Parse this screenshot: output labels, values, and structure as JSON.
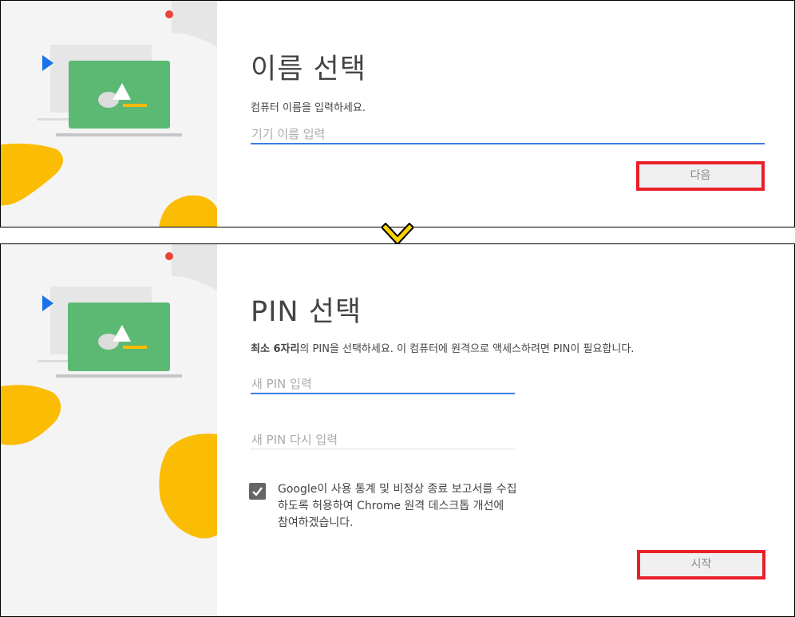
{
  "name_step": {
    "title": "이름 선택",
    "description": "컴퓨터 이름을 입력하세요.",
    "device_name_placeholder": "기기 이름 입력",
    "next_button": "다음"
  },
  "pin_step": {
    "title": "PIN 선택",
    "description_bold": "최소 6자리",
    "description_rest": "의 PIN을 선택하세요. 이 컴퓨터에 원격으로 액세스하려면 PIN이 필요합니다.",
    "pin_placeholder": "새 PIN 입력",
    "pin_confirm_placeholder": "새 PIN 다시 입력",
    "consent_checked": true,
    "consent_text": "Google이 사용 통계 및 비정상 종료 보고서를 수집하도록 허용하여 Chrome 원격 데스크톱 개선에 참여하겠습니다.",
    "start_button": "시작"
  },
  "colors": {
    "accent_blue": "#3b7de0",
    "highlight_red": "#e8202a",
    "illustration_green": "#5bb974",
    "illustration_yellow": "#fbbc04",
    "connector_yellow": "#f7d100"
  },
  "icons": {
    "connector": "chevron-down-icon",
    "checkbox": "check-icon"
  }
}
